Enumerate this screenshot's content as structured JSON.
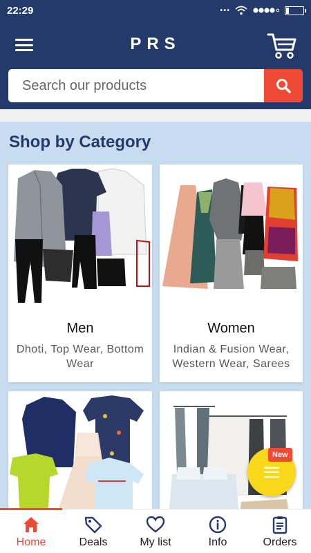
{
  "status_bar": {
    "time": "22:29"
  },
  "header": {
    "brand": "PRS",
    "search_placeholder": "Search our products"
  },
  "section_title": "Shop by Category",
  "categories": [
    {
      "name": "Men",
      "subtitle": "Dhoti, Top Wear, Bottom Wear"
    },
    {
      "name": "Women",
      "subtitle": "Indian & Fusion Wear, Western Wear, Sarees"
    },
    {
      "name": "",
      "subtitle": ""
    },
    {
      "name": "",
      "subtitle": ""
    }
  ],
  "fab": {
    "badge": "New"
  },
  "bottom_nav": {
    "items": [
      {
        "label": "Home",
        "icon": "home-icon",
        "active": true
      },
      {
        "label": "Deals",
        "icon": "tag-icon",
        "active": false
      },
      {
        "label": "My list",
        "icon": "heart-icon",
        "active": false
      },
      {
        "label": "Info",
        "icon": "info-icon",
        "active": false
      },
      {
        "label": "Orders",
        "icon": "clipboard-icon",
        "active": false
      }
    ]
  },
  "colors": {
    "header_bg": "#243a6b",
    "accent": "#ef4a35",
    "page_bg": "#c8dcf0",
    "fab": "#f9d81c"
  }
}
